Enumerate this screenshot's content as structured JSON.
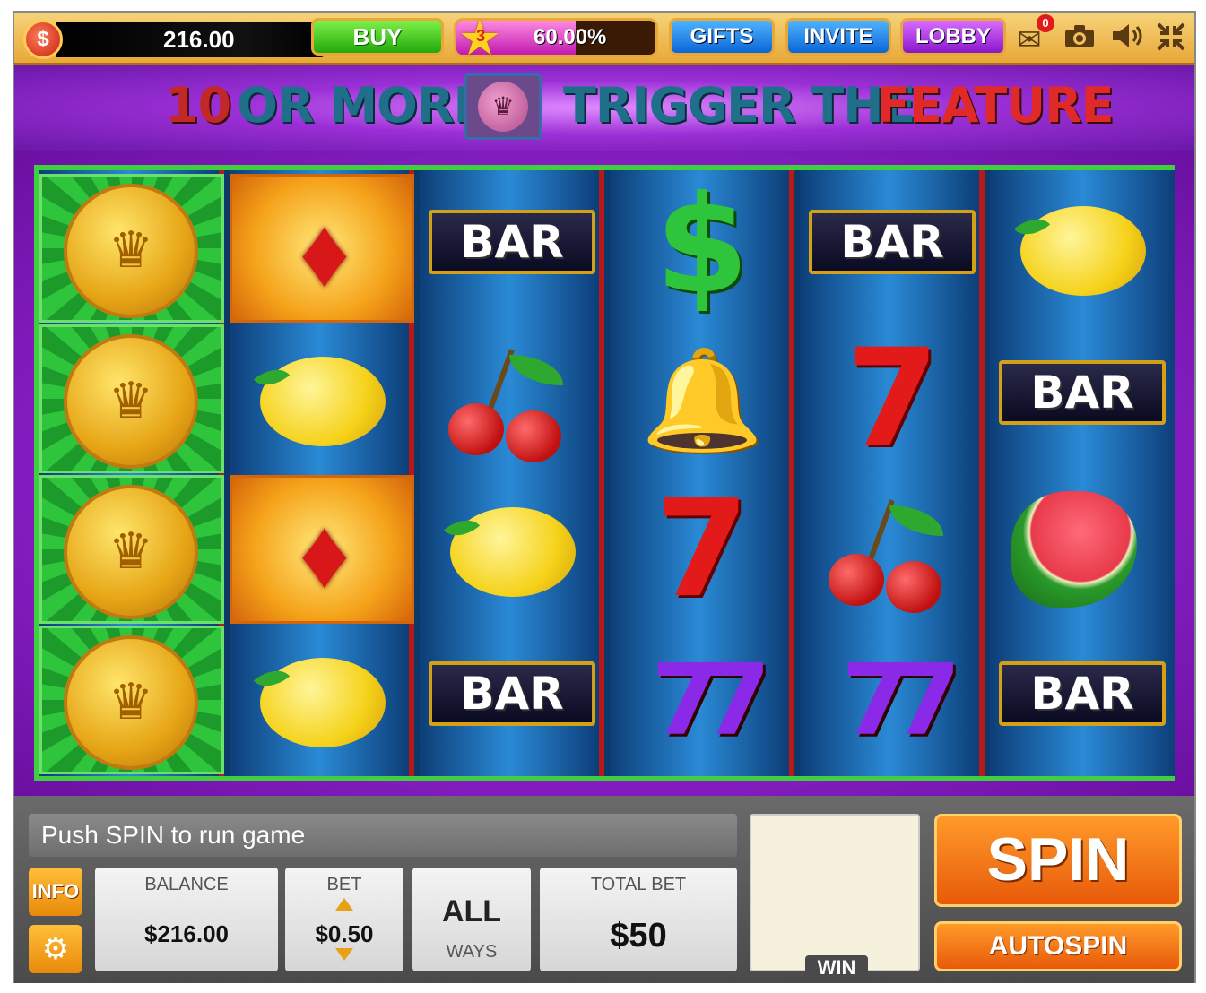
{
  "topbar": {
    "coin_glyph": "$",
    "balance": "216.00",
    "buy_label": "BUY",
    "level": "3",
    "level_progress": 0.6,
    "level_percent": "60.00%",
    "gifts_label": "GIFTS",
    "invite_label": "INVITE",
    "lobby_label": "LOBBY",
    "mail_count": "0",
    "icons": [
      "mail-icon",
      "camera-icon",
      "sound-icon",
      "fullscreen-icon"
    ]
  },
  "banner": {
    "part1": "10",
    "part2": "OR MORE",
    "part3": "TRIGGER THE",
    "part4": "FEATURE"
  },
  "reels": [
    [
      "crown-coin",
      "crown-coin",
      "crown-coin",
      "crown-coin"
    ],
    [
      "red-gem",
      "lemon",
      "red-gem",
      "lemon"
    ],
    [
      "bar",
      "cherry",
      "lemon",
      "bar"
    ],
    [
      "dollar",
      "bell",
      "red-seven",
      "purple-double-seven"
    ],
    [
      "bar",
      "red-seven",
      "cherry",
      "purple-double-seven"
    ],
    [
      "lemon",
      "bar",
      "watermelon",
      "bar"
    ]
  ],
  "symbols": {
    "bar_text": "BAR",
    "seven_text": "7",
    "sevens_text": "77",
    "dollar_text": "$"
  },
  "bottom": {
    "message": "Push SPIN to run game",
    "info_label": "INFO",
    "balance_label": "BALANCE",
    "balance_value": "$216.00",
    "bet_label": "BET",
    "bet_value": "$0.50",
    "ways_value": "ALL",
    "ways_label": "WAYS",
    "total_bet_label": "TOTAL BET",
    "total_bet_value": "$50",
    "win_label": "WIN",
    "spin_label": "SPIN",
    "autospin_label": "AUTOSPIN"
  },
  "colors": {
    "frame_gold": "#e8a838",
    "banner_purple": "#9b2fd6",
    "reel_green_border": "#3fcf3f",
    "reel_divider_red": "#b81818",
    "spin_orange": "#e85a0a"
  }
}
